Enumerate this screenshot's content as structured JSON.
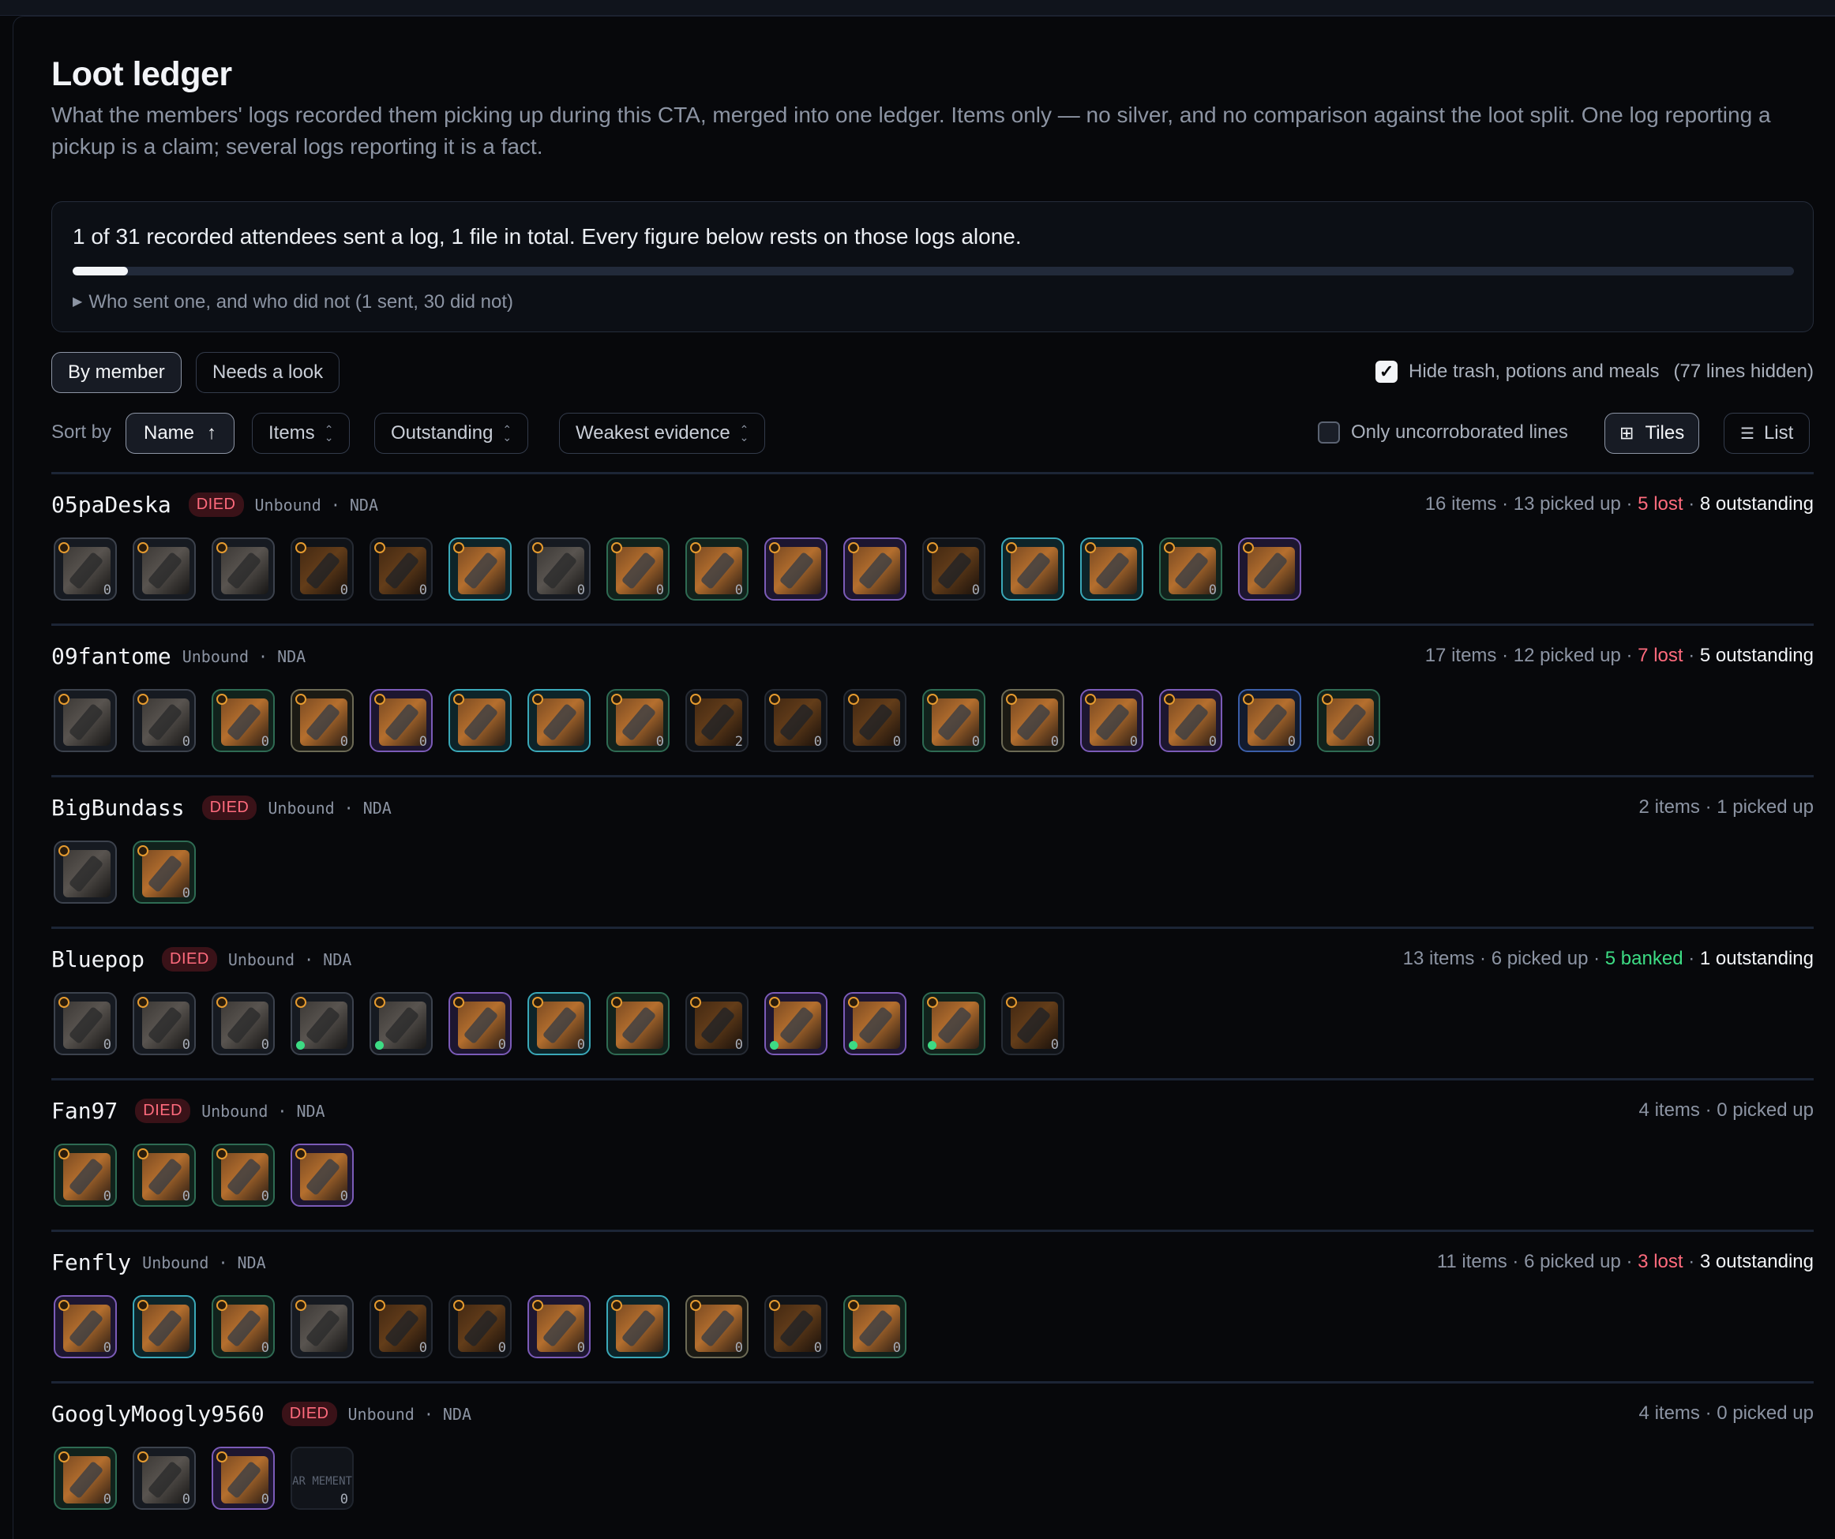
{
  "page": {
    "title": "Loot ledger",
    "subtitle": "What the members' logs recorded them picking up during this CTA, merged into one ledger. Items only — no silver, and no comparison against the loot split. One log reporting a pickup is a claim; several logs reporting it is a fact."
  },
  "notice": {
    "text": "1 of 31 recorded attendees sent a log, 1 file in total. Every figure below rests on those logs alone.",
    "progress_fraction": 0.0323,
    "details_label": "Who sent one, and who did not (1 sent, 30 did not)"
  },
  "views": {
    "by_member": "By member",
    "needs_look": "Needs a look"
  },
  "filters": {
    "hide_trash_label": "Hide trash, potions and meals",
    "hide_trash_checked": true,
    "hidden_count": "(77 lines hidden)",
    "uncorroborated_label": "Only uncorroborated lines",
    "uncorroborated_checked": false
  },
  "sort": {
    "label": "Sort by",
    "options": [
      "Name",
      "Items",
      "Outstanding",
      "Weakest evidence"
    ],
    "active_arrow": "↑"
  },
  "layout_toggle": {
    "tiles": "Tiles",
    "list": "List",
    "selected": "Tiles"
  },
  "icons": {
    "check": "check-icon",
    "sort_arrow": "arrow-up-icon",
    "sort_chevron": "chevron-updown-icon",
    "grid": "grid-icon",
    "list": "list-icon",
    "disclosure": "triangle-right-icon",
    "tier": "tier-ring-icon"
  },
  "colors": {
    "died_badge_bg": "#3a1218",
    "died_badge_text": "#ff6b7d",
    "lost": "#ff6b7d",
    "banked": "#3ddc84",
    "outstanding": "#f3f5f8"
  },
  "members": [
    {
      "name": "05paDeska",
      "died": true,
      "died_label": "DIED",
      "bound": "Unbound",
      "guild": "NDA",
      "summary": {
        "items": "16 items",
        "picked": "13 picked up",
        "lost": "5 lost",
        "banked": "",
        "outstanding": "8 outstanding"
      },
      "tiles": [
        {
          "c": "c-gray",
          "q": "0"
        },
        {
          "c": "c-gray",
          "q": ""
        },
        {
          "c": "c-gray",
          "q": ""
        },
        {
          "c": "c-dark",
          "q": "0"
        },
        {
          "c": "c-dark",
          "q": "0"
        },
        {
          "c": "c-cyan",
          "q": ""
        },
        {
          "c": "c-gray",
          "q": "0"
        },
        {
          "c": "c-green",
          "q": "0"
        },
        {
          "c": "c-green",
          "q": "0"
        },
        {
          "c": "c-purple",
          "q": ""
        },
        {
          "c": "c-purple",
          "q": ""
        },
        {
          "c": "c-dark",
          "q": "0"
        },
        {
          "c": "c-cyan",
          "q": ""
        },
        {
          "c": "c-cyan",
          "q": ""
        },
        {
          "c": "c-green",
          "q": "0"
        },
        {
          "c": "c-purple",
          "q": ""
        }
      ]
    },
    {
      "name": "09fantome",
      "died": false,
      "died_label": "",
      "bound": "Unbound",
      "guild": "NDA",
      "summary": {
        "items": "17 items",
        "picked": "12 picked up",
        "lost": "7 lost",
        "banked": "",
        "outstanding": "5 outstanding"
      },
      "tiles": [
        {
          "c": "c-gray",
          "q": ""
        },
        {
          "c": "c-gray",
          "q": "0"
        },
        {
          "c": "c-green",
          "q": "0"
        },
        {
          "c": "c-gold",
          "q": "0"
        },
        {
          "c": "c-purple",
          "q": "0"
        },
        {
          "c": "c-cyan",
          "q": ""
        },
        {
          "c": "c-cyan",
          "q": ""
        },
        {
          "c": "c-green",
          "q": "0"
        },
        {
          "c": "c-dark",
          "q": "2"
        },
        {
          "c": "c-dark",
          "q": "0"
        },
        {
          "c": "c-dark",
          "q": "0"
        },
        {
          "c": "c-green",
          "q": "0"
        },
        {
          "c": "c-gold",
          "q": "0"
        },
        {
          "c": "c-purple",
          "q": "0"
        },
        {
          "c": "c-purple",
          "q": "0"
        },
        {
          "c": "c-blue",
          "q": "0"
        },
        {
          "c": "c-green",
          "q": "0"
        }
      ]
    },
    {
      "name": "BigBundass",
      "died": true,
      "died_label": "DIED",
      "bound": "Unbound",
      "guild": "NDA",
      "summary": {
        "items": "2 items",
        "picked": "1 picked up",
        "lost": "",
        "banked": "",
        "outstanding": ""
      },
      "tiles": [
        {
          "c": "c-gray",
          "q": ""
        },
        {
          "c": "c-green",
          "q": "0"
        }
      ]
    },
    {
      "name": "Bluepop",
      "died": true,
      "died_label": "DIED",
      "bound": "Unbound",
      "guild": "NDA",
      "summary": {
        "items": "13 items",
        "picked": "6 picked up",
        "lost": "",
        "banked": "5 banked",
        "outstanding": "1 outstanding"
      },
      "tiles": [
        {
          "c": "c-gray",
          "q": "0"
        },
        {
          "c": "c-gray",
          "q": "0"
        },
        {
          "c": "c-gray",
          "q": "0"
        },
        {
          "c": "c-gray",
          "q": "",
          "g": true
        },
        {
          "c": "c-gray",
          "q": "",
          "g": true
        },
        {
          "c": "c-purple",
          "q": "0"
        },
        {
          "c": "c-cyan",
          "q": "0"
        },
        {
          "c": "c-green",
          "q": ""
        },
        {
          "c": "c-dark",
          "q": "0"
        },
        {
          "c": "c-purple",
          "q": "",
          "g": true
        },
        {
          "c": "c-purple",
          "q": "",
          "g": true
        },
        {
          "c": "c-green",
          "q": "",
          "g": true
        },
        {
          "c": "c-dark",
          "q": "0"
        }
      ]
    },
    {
      "name": "Fan97",
      "died": true,
      "died_label": "DIED",
      "bound": "Unbound",
      "guild": "NDA",
      "summary": {
        "items": "4 items",
        "picked": "0 picked up",
        "lost": "",
        "banked": "",
        "outstanding": ""
      },
      "tiles": [
        {
          "c": "c-green",
          "q": "0"
        },
        {
          "c": "c-green",
          "q": "0"
        },
        {
          "c": "c-green",
          "q": "0"
        },
        {
          "c": "c-purple",
          "q": "0"
        }
      ]
    },
    {
      "name": "Fenfly",
      "died": false,
      "died_label": "",
      "bound": "Unbound",
      "guild": "NDA",
      "summary": {
        "items": "11 items",
        "picked": "6 picked up",
        "lost": "3 lost",
        "banked": "",
        "outstanding": "3 outstanding"
      },
      "tiles": [
        {
          "c": "c-purple",
          "q": "0"
        },
        {
          "c": "c-cyan",
          "q": ""
        },
        {
          "c": "c-green",
          "q": "0"
        },
        {
          "c": "c-gray",
          "q": ""
        },
        {
          "c": "c-dark",
          "q": "0"
        },
        {
          "c": "c-dark",
          "q": "0"
        },
        {
          "c": "c-purple",
          "q": "0"
        },
        {
          "c": "c-cyan",
          "q": ""
        },
        {
          "c": "c-gold",
          "q": "0"
        },
        {
          "c": "c-dark",
          "q": "0"
        },
        {
          "c": "c-green",
          "q": "0"
        }
      ]
    },
    {
      "name": "GooglyMoogly9560",
      "died": true,
      "died_label": "DIED",
      "bound": "Unbound",
      "guild": "NDA",
      "summary": {
        "items": "4 items",
        "picked": "0 picked up",
        "lost": "",
        "banked": "",
        "outstanding": ""
      },
      "tiles": [
        {
          "c": "c-green",
          "q": "0"
        },
        {
          "c": "c-gray",
          "q": "0"
        },
        {
          "c": "c-purple",
          "q": "0"
        },
        {
          "c": "c-empty",
          "q": "0",
          "ph": "AR MEMENT"
        }
      ]
    }
  ]
}
